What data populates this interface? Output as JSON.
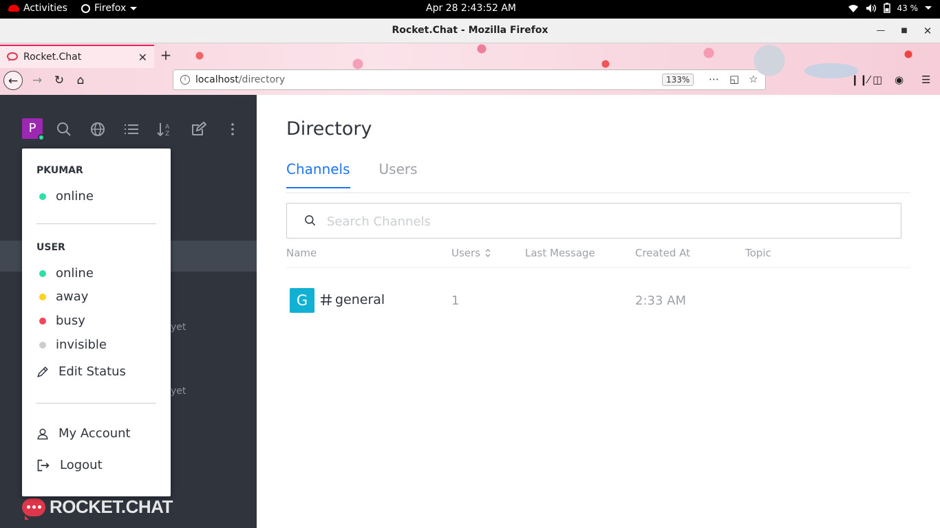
{
  "os_bar": {
    "activities": "Activities",
    "app_menu": "Firefox",
    "clock": "Apr 28  2:43:52 AM",
    "battery": "43 %"
  },
  "window": {
    "title": "Rocket.Chat - Mozilla Firefox"
  },
  "browser": {
    "tab_title": "Rocket.Chat",
    "url_host": "localhost",
    "url_path": "/directory",
    "zoom": "133%"
  },
  "sidebar": {
    "avatar_letter": "P",
    "faint_text_1": "yet",
    "faint_text_2": "yet",
    "logo_text": "ROCKET.CHAT"
  },
  "status_menu": {
    "username": "PKUMAR",
    "current_status": "online",
    "user_section": "USER",
    "statuses": [
      {
        "label": "online",
        "color": "#2de0a5"
      },
      {
        "label": "away",
        "color": "#ffd21f"
      },
      {
        "label": "busy",
        "color": "#f5455c"
      },
      {
        "label": "invisible",
        "color": "#cbced1"
      }
    ],
    "edit_status": "Edit Status",
    "my_account": "My Account",
    "logout": "Logout"
  },
  "directory": {
    "title": "Directory",
    "tabs": [
      "Channels",
      "Users"
    ],
    "search_placeholder": "Search Channels",
    "columns": [
      "Name",
      "Users",
      "Last Message",
      "Created At",
      "Topic"
    ],
    "rows": [
      {
        "avatar": "G",
        "name": "general",
        "users": "1",
        "last_message": "",
        "created_at": "2:33 AM",
        "topic": ""
      }
    ]
  },
  "colors": {
    "accent": "#1d74f5",
    "sidebar_bg": "#2f343d",
    "avatar_user": "#9c27b0",
    "avatar_channel": "#11b1d3"
  }
}
